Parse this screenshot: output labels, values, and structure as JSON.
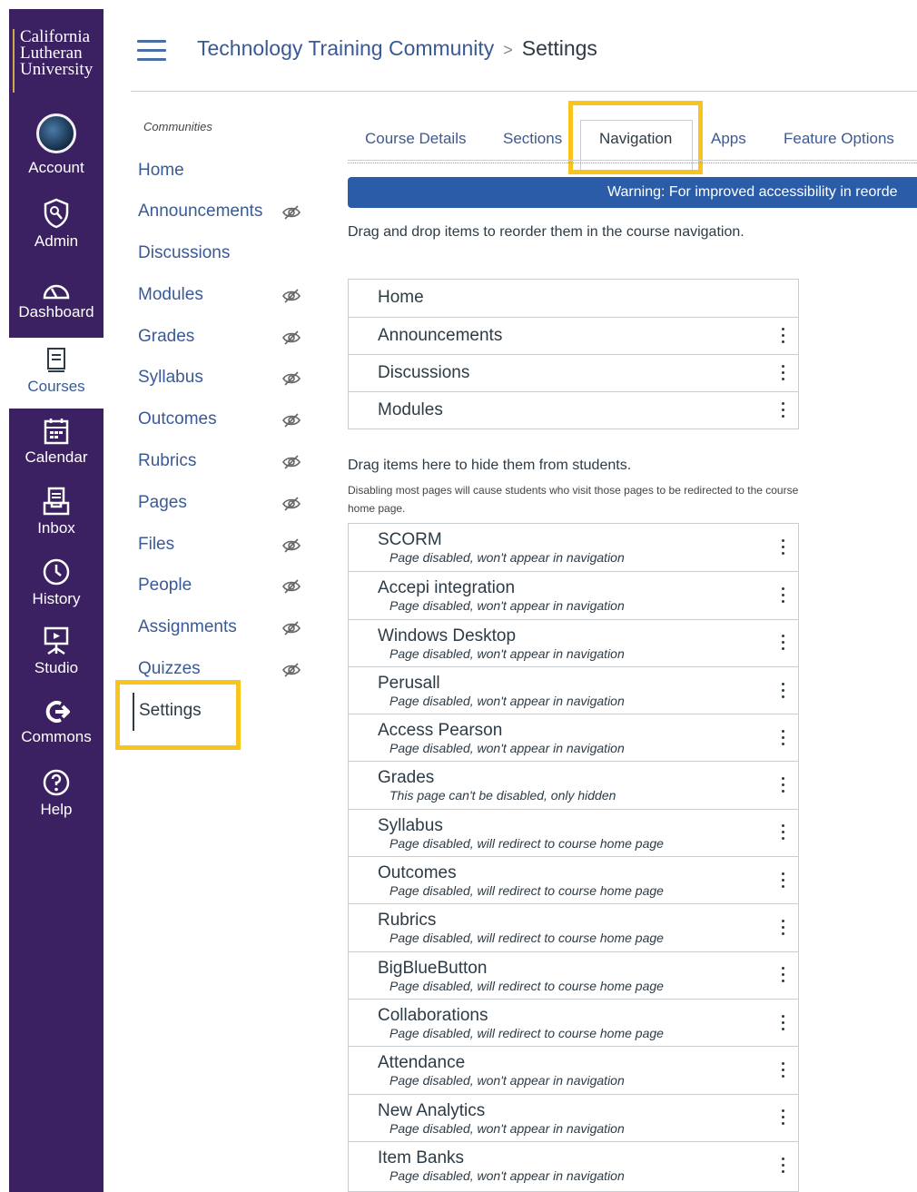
{
  "logo": {
    "line1": "California",
    "line2": "Lutheran",
    "line3": "University"
  },
  "global_nav": [
    {
      "label": "Account",
      "icon": "avatar-icon"
    },
    {
      "label": "Admin",
      "icon": "shield-icon"
    },
    {
      "label": "Dashboard",
      "icon": "gauge-icon"
    },
    {
      "label": "Courses",
      "icon": "book-icon"
    },
    {
      "label": "Calendar",
      "icon": "calendar-icon"
    },
    {
      "label": "Inbox",
      "icon": "inbox-icon"
    },
    {
      "label": "History",
      "icon": "clock-icon"
    },
    {
      "label": "Studio",
      "icon": "studio-icon"
    },
    {
      "label": "Commons",
      "icon": "commons-icon"
    },
    {
      "label": "Help",
      "icon": "help-icon"
    }
  ],
  "breadcrumb": {
    "course": "Technology Training Community",
    "separator": ">",
    "current": "Settings"
  },
  "course_nav": {
    "title": "Communities",
    "items": [
      {
        "label": "Home",
        "hidden": false
      },
      {
        "label": "Announcements",
        "hidden": true
      },
      {
        "label": "Discussions",
        "hidden": false
      },
      {
        "label": "Modules",
        "hidden": true
      },
      {
        "label": "Grades",
        "hidden": true
      },
      {
        "label": "Syllabus",
        "hidden": true
      },
      {
        "label": "Outcomes",
        "hidden": true
      },
      {
        "label": "Rubrics",
        "hidden": true
      },
      {
        "label": "Pages",
        "hidden": true
      },
      {
        "label": "Files",
        "hidden": true
      },
      {
        "label": "People",
        "hidden": true
      },
      {
        "label": "Assignments",
        "hidden": true
      },
      {
        "label": "Quizzes",
        "hidden": true
      }
    ],
    "active": "Settings"
  },
  "tabs": [
    "Course Details",
    "Sections",
    "Navigation",
    "Apps",
    "Feature Options"
  ],
  "warning": "Warning: For improved accessibility in reorde",
  "instructions": "Drag and drop items to reorder them in the course navigation.",
  "visible_items": [
    "Home",
    "Announcements",
    "Discussions",
    "Modules"
  ],
  "hidden_heading": "Drag items here to hide them from students.",
  "hidden_note": "Disabling most pages will cause students who visit those pages to be redirected to the course home page.",
  "hidden_items": [
    {
      "name": "SCORM",
      "status": "Page disabled, won't appear in navigation"
    },
    {
      "name": "Accepi integration",
      "status": "Page disabled, won't appear in navigation"
    },
    {
      "name": "Windows Desktop",
      "status": "Page disabled, won't appear in navigation"
    },
    {
      "name": "Perusall",
      "status": "Page disabled, won't appear in navigation"
    },
    {
      "name": "Access Pearson",
      "status": "Page disabled, won't appear in navigation"
    },
    {
      "name": "Grades",
      "status": "This page can't be disabled, only hidden"
    },
    {
      "name": "Syllabus",
      "status": "Page disabled, will redirect to course home page"
    },
    {
      "name": "Outcomes",
      "status": "Page disabled, will redirect to course home page"
    },
    {
      "name": "Rubrics",
      "status": "Page disabled, will redirect to course home page"
    },
    {
      "name": "BigBlueButton",
      "status": "Page disabled, will redirect to course home page"
    },
    {
      "name": "Collaborations",
      "status": "Page disabled, will redirect to course home page"
    },
    {
      "name": "Attendance",
      "status": "Page disabled, won't appear in navigation"
    },
    {
      "name": "New Analytics",
      "status": "Page disabled, won't appear in navigation"
    },
    {
      "name": "Item Banks",
      "status": "Page disabled, won't appear in navigation"
    }
  ],
  "colors": {
    "global_nav_bg": "#3b2161",
    "link": "#3a5a95",
    "highlight": "#f7c51e",
    "warning_bg": "#2a5ca8"
  }
}
